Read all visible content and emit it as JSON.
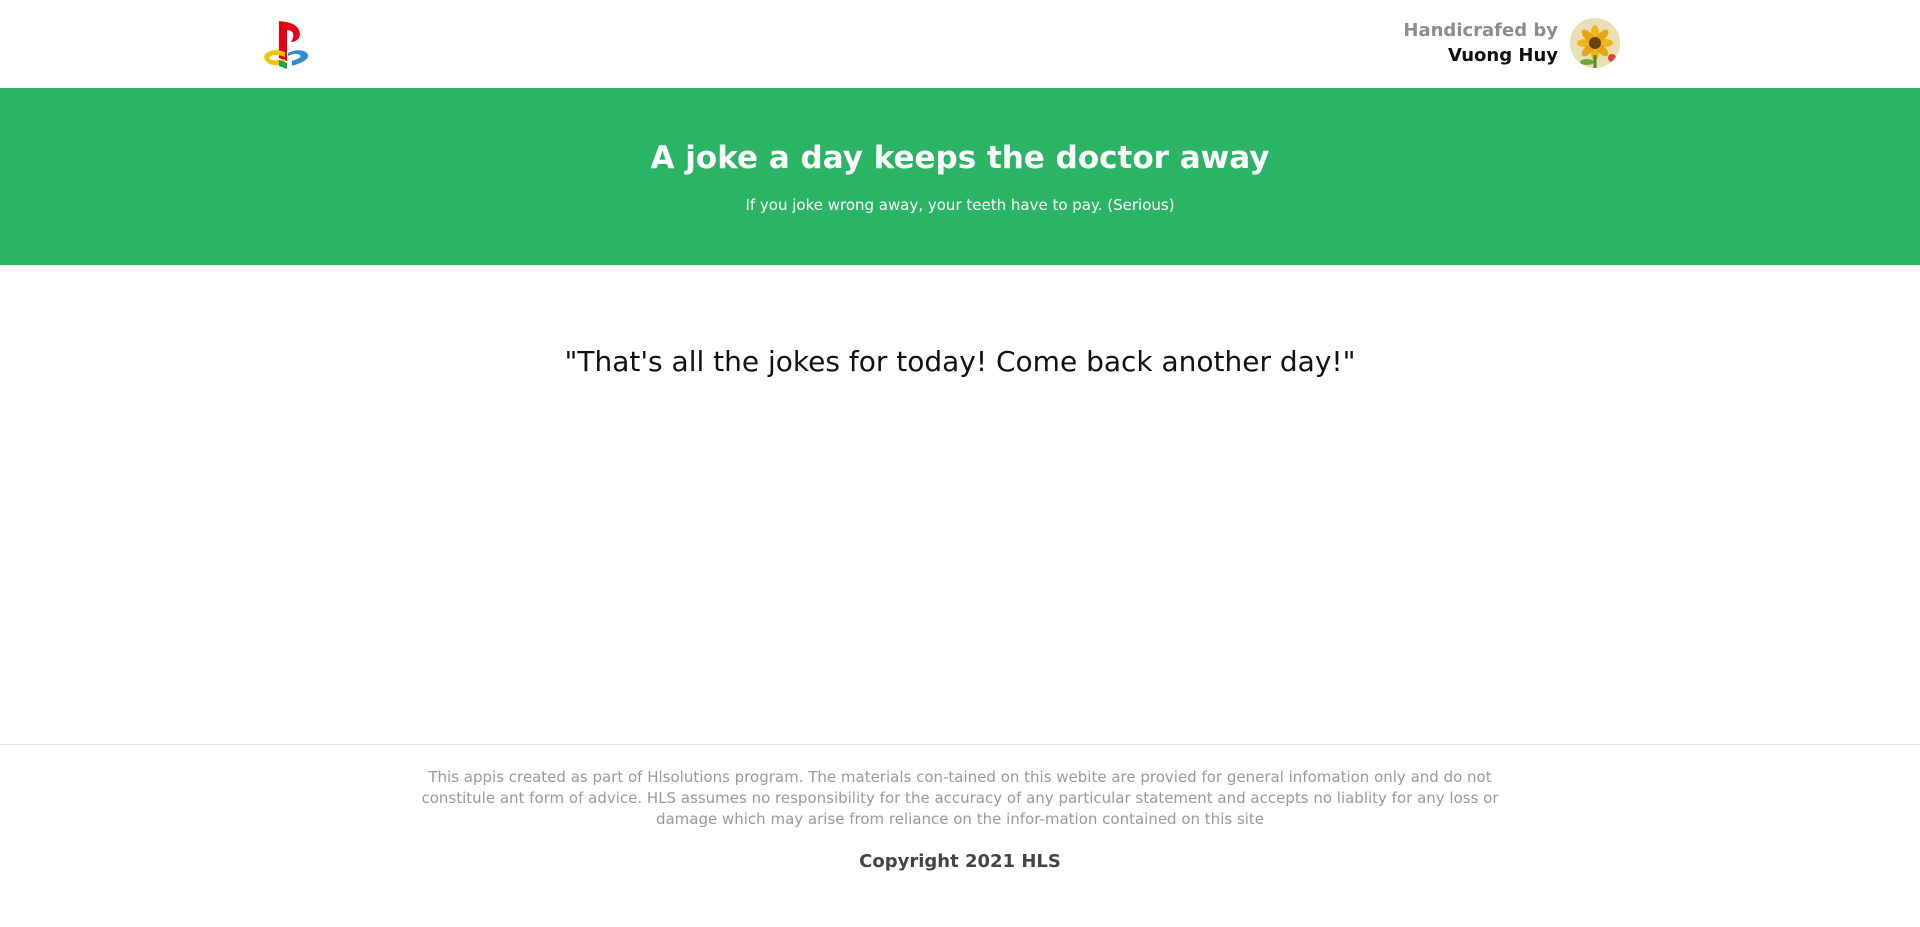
{
  "header": {
    "logo_icon": "playstation-logo-icon",
    "author_label": "Handicrafed by",
    "author_name": "Vuong Huy",
    "avatar_icon": "sunflower-avatar-icon"
  },
  "hero": {
    "title": "A joke a day keeps the doctor away",
    "subtitle": "If you joke wrong away, your teeth have to pay. (Serious)",
    "background_color": "#2bb463"
  },
  "main": {
    "joke_text": "\"That's all the jokes for today! Come back another day!\""
  },
  "footer": {
    "disclaimer": "This appis created as part of Hlsolutions program. The materials con-tained on this webite are provied for general infomation only and do not constitule ant form of advice. HLS assumes no responsibility for the accuracy of any particular statement and accepts no liablity for any loss or damage which may arise from reliance on the infor-mation contained on this site",
    "copyright": "Copyright 2021 HLS"
  }
}
